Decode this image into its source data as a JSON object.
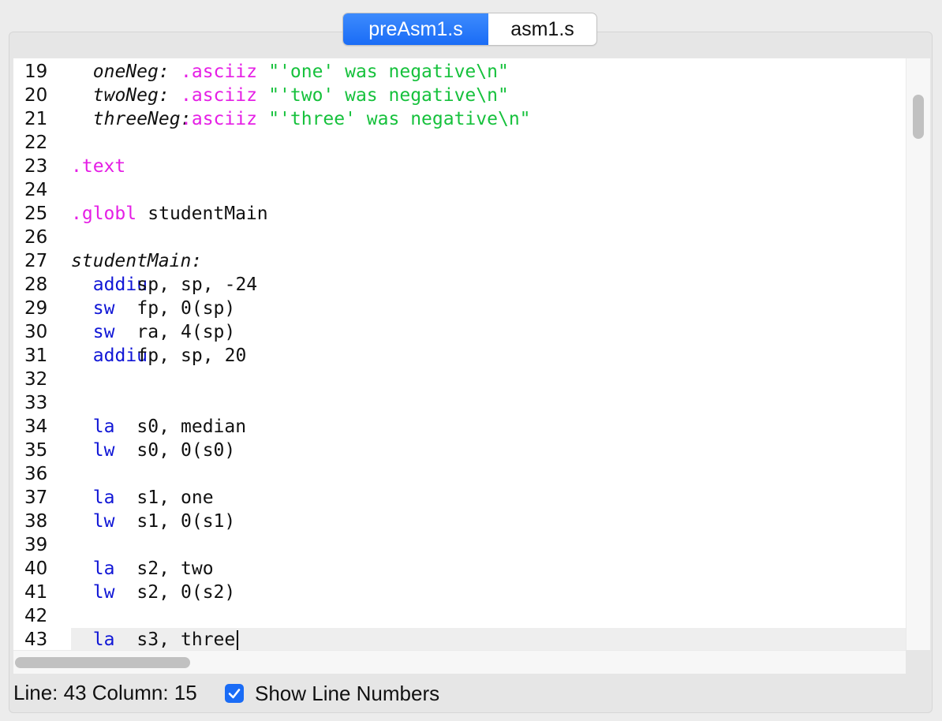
{
  "tabs": [
    {
      "label": "preAsm1.s",
      "active": true
    },
    {
      "label": "asm1.s",
      "active": false
    }
  ],
  "editor": {
    "current_line": 43,
    "lines": [
      {
        "n": "19",
        "tokens": [
          {
            "t": "oneNeg:",
            "c": "lbl",
            "col": 2
          },
          {
            "t": ".asciiz",
            "c": "dir",
            "col": 10
          },
          {
            "t": "\"'one' was negative\\n\"",
            "c": "str",
            "col": 18
          }
        ]
      },
      {
        "n": "20",
        "tokens": [
          {
            "t": "twoNeg:",
            "c": "lbl",
            "col": 2
          },
          {
            "t": ".asciiz",
            "c": "dir",
            "col": 10
          },
          {
            "t": "\"'two' was negative\\n\"",
            "c": "str",
            "col": 18
          }
        ]
      },
      {
        "n": "21",
        "tokens": [
          {
            "t": "threeNeg:",
            "c": "lbl",
            "col": 2
          },
          {
            "t": ".asciiz",
            "c": "dir",
            "col": 10
          },
          {
            "t": "\"'three' was negative\\n\"",
            "c": "str",
            "col": 18
          }
        ]
      },
      {
        "n": "22",
        "tokens": []
      },
      {
        "n": "23",
        "tokens": [
          {
            "t": ".text",
            "c": "dir",
            "col": 0
          }
        ]
      },
      {
        "n": "24",
        "tokens": []
      },
      {
        "n": "25",
        "tokens": [
          {
            "t": ".globl",
            "c": "dir",
            "col": 0
          },
          {
            "t": "studentMain",
            "c": "txt",
            "col": 7
          }
        ]
      },
      {
        "n": "26",
        "tokens": []
      },
      {
        "n": "27",
        "tokens": [
          {
            "t": "studentMain:",
            "c": "lbl",
            "col": 0
          }
        ]
      },
      {
        "n": "28",
        "tokens": [
          {
            "t": "addiu",
            "c": "ins",
            "col": 2
          },
          {
            "t": "sp,",
            "c": "txt",
            "col": 6
          },
          {
            "t": "sp,",
            "c": "txt",
            "col": 10
          },
          {
            "t": "-24",
            "c": "txt",
            "col": 14
          }
        ]
      },
      {
        "n": "29",
        "tokens": [
          {
            "t": "sw",
            "c": "ins",
            "col": 2
          },
          {
            "t": "fp,",
            "c": "txt",
            "col": 6
          },
          {
            "t": "0(sp)",
            "c": "txt",
            "col": 10
          }
        ]
      },
      {
        "n": "30",
        "tokens": [
          {
            "t": "sw",
            "c": "ins",
            "col": 2
          },
          {
            "t": "ra,",
            "c": "txt",
            "col": 6
          },
          {
            "t": "4(sp)",
            "c": "txt",
            "col": 10
          }
        ]
      },
      {
        "n": "31",
        "tokens": [
          {
            "t": "addiu",
            "c": "ins",
            "col": 2
          },
          {
            "t": "fp,",
            "c": "txt",
            "col": 6
          },
          {
            "t": "sp,",
            "c": "txt",
            "col": 10
          },
          {
            "t": "20",
            "c": "txt",
            "col": 14
          }
        ]
      },
      {
        "n": "32",
        "tokens": []
      },
      {
        "n": "33",
        "tokens": []
      },
      {
        "n": "34",
        "tokens": [
          {
            "t": "la",
            "c": "ins",
            "col": 2
          },
          {
            "t": "s0,",
            "c": "txt",
            "col": 6
          },
          {
            "t": "median",
            "c": "txt",
            "col": 10
          }
        ]
      },
      {
        "n": "35",
        "tokens": [
          {
            "t": "lw",
            "c": "ins",
            "col": 2
          },
          {
            "t": "s0,",
            "c": "txt",
            "col": 6
          },
          {
            "t": "0(s0)",
            "c": "txt",
            "col": 10
          }
        ]
      },
      {
        "n": "36",
        "tokens": []
      },
      {
        "n": "37",
        "tokens": [
          {
            "t": "la",
            "c": "ins",
            "col": 2
          },
          {
            "t": "s1,",
            "c": "txt",
            "col": 6
          },
          {
            "t": "one",
            "c": "txt",
            "col": 10
          }
        ]
      },
      {
        "n": "38",
        "tokens": [
          {
            "t": "lw",
            "c": "ins",
            "col": 2
          },
          {
            "t": "s1,",
            "c": "txt",
            "col": 6
          },
          {
            "t": "0(s1)",
            "c": "txt",
            "col": 10
          }
        ]
      },
      {
        "n": "39",
        "tokens": []
      },
      {
        "n": "40",
        "tokens": [
          {
            "t": "la",
            "c": "ins",
            "col": 2
          },
          {
            "t": "s2,",
            "c": "txt",
            "col": 6
          },
          {
            "t": "two",
            "c": "txt",
            "col": 10
          }
        ]
      },
      {
        "n": "41",
        "tokens": [
          {
            "t": "lw",
            "c": "ins",
            "col": 2
          },
          {
            "t": "s2,",
            "c": "txt",
            "col": 6
          },
          {
            "t": "0(s2)",
            "c": "txt",
            "col": 10
          }
        ]
      },
      {
        "n": "42",
        "tokens": []
      },
      {
        "n": "43",
        "tokens": [
          {
            "t": "la",
            "c": "ins",
            "col": 2
          },
          {
            "t": "s3,",
            "c": "txt",
            "col": 6
          },
          {
            "t": "three",
            "c": "txt",
            "col": 10
          }
        ]
      }
    ]
  },
  "status": {
    "position_text": "Line: 43 Column: 15",
    "show_line_numbers_label": "Show Line Numbers",
    "show_line_numbers_checked": true
  },
  "colors": {
    "directive": "#e51ee5",
    "instruction": "#1016d6",
    "string": "#16c13c",
    "accent": "#1a6cf6"
  }
}
